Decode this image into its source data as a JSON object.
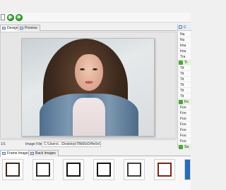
{
  "tabs": [
    {
      "label": "Design"
    },
    {
      "label": "Preview"
    }
  ],
  "status": {
    "page": "1/1",
    "image_file_label": "Image File:",
    "image_file_value": "C:\\Users\\...\\Desktop\\78b60d1f4e0e9f72b5685fd0a1d0db.jpg"
  },
  "bottom_tabs": [
    {
      "label": "Frame Images"
    },
    {
      "label": "Back Images"
    }
  ],
  "right_panel": {
    "header": "C",
    "rows": [
      {
        "label": "Na"
      },
      {
        "label": "Nu"
      },
      {
        "label": "Ima"
      },
      {
        "label": "Ima"
      },
      {
        "label": "Tra"
      },
      {
        "label": "Ti",
        "category": true
      },
      {
        "label": "Tit"
      },
      {
        "label": "Tit"
      },
      {
        "label": "Tit"
      },
      {
        "label": "Tit"
      },
      {
        "label": "Tit"
      },
      {
        "label": "Tit"
      },
      {
        "label": "Fo",
        "category": true
      },
      {
        "label": "Foo"
      },
      {
        "label": "Foo"
      },
      {
        "label": "Foo"
      },
      {
        "label": "Foo"
      },
      {
        "label": "Foo"
      },
      {
        "label": "Foo"
      },
      {
        "label": "Foo"
      },
      {
        "label": "Sa",
        "category": true
      }
    ]
  },
  "frames": [
    {
      "name": "frame-1"
    },
    {
      "name": "frame-2"
    },
    {
      "name": "frame-3"
    },
    {
      "name": "frame-4"
    },
    {
      "name": "frame-5"
    },
    {
      "name": "frame-6"
    },
    {
      "name": "frame-7"
    }
  ],
  "icons": {
    "toolbar": [
      "new-document-icon",
      "play-icon",
      "stop-icon"
    ]
  }
}
